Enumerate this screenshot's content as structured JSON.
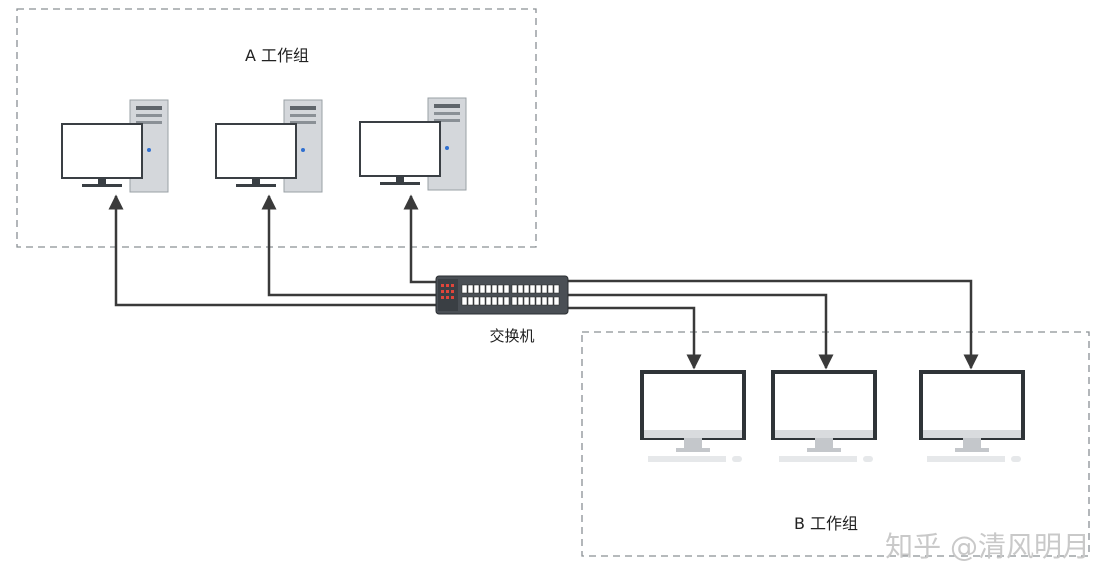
{
  "groups": {
    "a": {
      "label": "A 工作组",
      "computers": 3
    },
    "b": {
      "label": "B 工作组",
      "computers": 3
    }
  },
  "switch": {
    "label": "交换机"
  },
  "watermark": "知乎 @清风明月",
  "colors": {
    "line": "#3a3a3a",
    "dashed_border": "#8a9094",
    "monitor_frame": "#2f3438",
    "tower": "#c8ccd0",
    "switch_body": "#4a4f55"
  }
}
